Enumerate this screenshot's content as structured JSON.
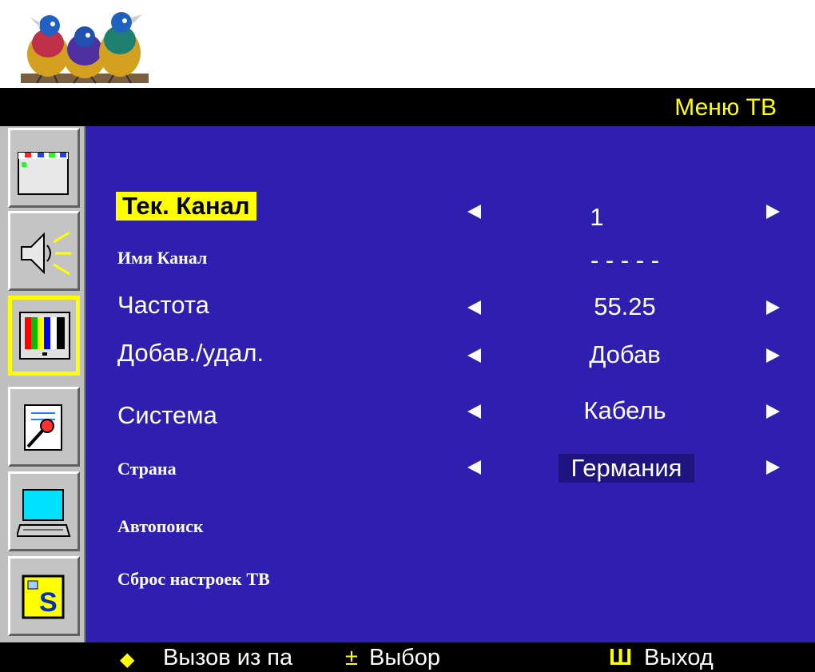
{
  "window": {
    "title": "Меню ТВ"
  },
  "icons": {
    "logo": "birds-logo-icon",
    "tabs": [
      "picture-window-icon",
      "speaker-icon",
      "tv-color-bars-icon",
      "tools-icon",
      "pc-monitor-icon",
      "ez-setup-icon"
    ]
  },
  "menu": {
    "current_channel": {
      "label": "Тек. Канал",
      "value": "1"
    },
    "channel_name": {
      "label": "Имя  Канал",
      "value": "- - - - -"
    },
    "frequency": {
      "label": "Частота",
      "value": "55.25"
    },
    "add_remove": {
      "label": "Добав./удал.",
      "value": "Добав"
    },
    "system": {
      "label": "Система",
      "value": "Кабель"
    },
    "country": {
      "label": "Страна",
      "value": "Германия"
    },
    "auto_search": {
      "label": "Автопоиск"
    },
    "reset": {
      "label": "Сброс настроек ТВ"
    }
  },
  "footer": {
    "nav_symbol": "◆",
    "nav_label": "Вызов из па",
    "select_symbol": "±",
    "select_label": "Выбор",
    "exit_symbol": "Ш",
    "exit_label": "Выход"
  },
  "colors": {
    "panel": "#2e1fb0",
    "accent": "#ffff00",
    "titlebar": "#000000"
  }
}
